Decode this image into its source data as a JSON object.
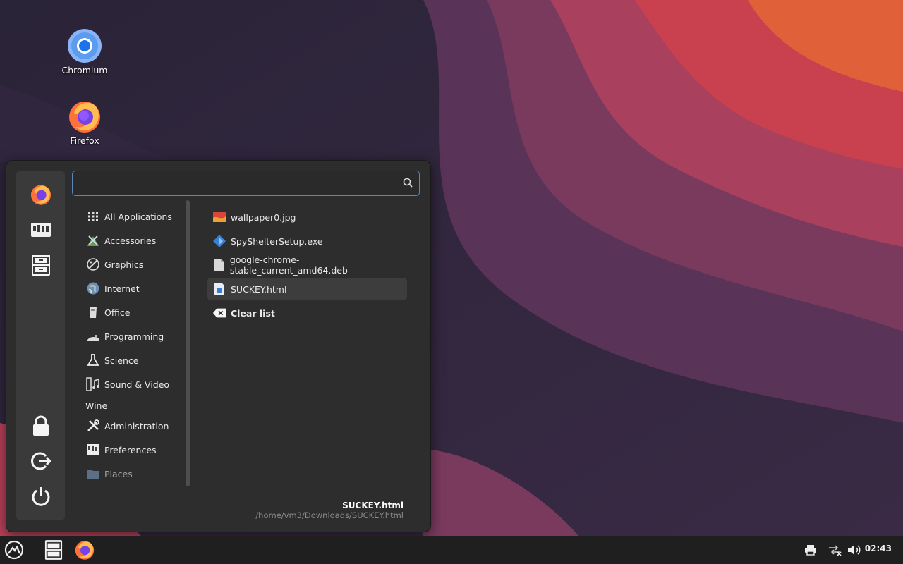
{
  "desktop": {
    "icons": [
      {
        "label": "Chromium",
        "icon": "chromium-icon"
      },
      {
        "label": "Firefox",
        "icon": "firefox-icon"
      }
    ]
  },
  "menu": {
    "search": {
      "value": "",
      "placeholder": ""
    },
    "favorites": [
      "firefox-icon",
      "settings-manager-icon",
      "file-manager-icon"
    ],
    "session": [
      "lock-icon",
      "logout-icon",
      "power-icon"
    ],
    "categories": [
      {
        "label": "All Applications",
        "icon": "grid-icon"
      },
      {
        "label": "Accessories",
        "icon": "accessories-icon"
      },
      {
        "label": "Graphics",
        "icon": "graphics-icon"
      },
      {
        "label": "Internet",
        "icon": "globe-icon"
      },
      {
        "label": "Office",
        "icon": "office-icon"
      },
      {
        "label": "Programming",
        "icon": "programming-icon"
      },
      {
        "label": "Science",
        "icon": "flask-icon"
      },
      {
        "label": "Sound & Video",
        "icon": "film-music-icon"
      },
      {
        "label": "Wine",
        "icon": ""
      },
      {
        "label": "Administration",
        "icon": "tools-icon"
      },
      {
        "label": "Preferences",
        "icon": "preferences-icon"
      },
      {
        "label": "Places",
        "icon": "folder-icon"
      }
    ],
    "recent_files": [
      {
        "label": "wallpaper0.jpg",
        "icon": "image-file-icon"
      },
      {
        "label": "SpyShelterSetup.exe",
        "icon": "exe-file-icon"
      },
      {
        "label": "google-chrome-stable_current_amd64.deb",
        "icon": "package-file-icon"
      },
      {
        "label": "SUCKEY.html",
        "icon": "html-file-icon",
        "selected": true
      }
    ],
    "clear_list_label": "Clear list",
    "info": {
      "name": "SUCKEY.html",
      "path": "/home/vm3/Downloads/SUCKEY.html"
    }
  },
  "taskbar": {
    "launchers": [
      "whisker-menu-icon",
      "file-manager-icon",
      "firefox-icon"
    ],
    "tray": [
      "printer-icon",
      "network-disconnected-icon",
      "volume-icon"
    ],
    "clock": "02:43"
  },
  "colors": {
    "accent": "#5a86b8",
    "menu_bg": "#2d2d2d",
    "taskbar_bg": "#1f1f1f"
  }
}
